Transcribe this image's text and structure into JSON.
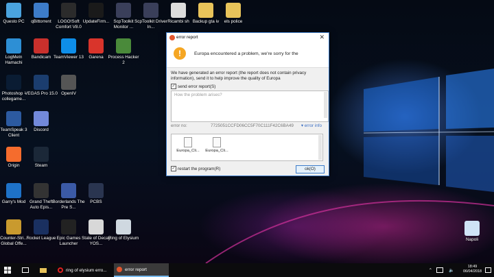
{
  "desktop_icons": [
    {
      "label": "Questo PC",
      "icon": "computer-icon",
      "color": "#4aa3df"
    },
    {
      "label": "qBittorrent",
      "icon": "qbittorrent-icon",
      "color": "#3d7cc9"
    },
    {
      "label": "LOGO!Soft Comfort V8.0",
      "icon": "logosoft-icon",
      "color": "#2b2b2b"
    },
    {
      "label": "UpdateFirm...",
      "icon": "update-firmware-icon",
      "color": "#1a1a1a"
    },
    {
      "label": "ScpToolkit Monitor ...",
      "icon": "scptoolkit-monitor-icon",
      "color": "#3a3f5a"
    },
    {
      "label": "ScpToolkit Driver In...",
      "icon": "scptoolkit-driver-icon",
      "color": "#3a3f5a"
    },
    {
      "label": "Ricambi sh",
      "icon": "file-icon",
      "color": "#dcdcdc"
    },
    {
      "label": "Backup gta iv",
      "icon": "folder-icon",
      "color": "#e8c35a"
    },
    {
      "label": "els police",
      "icon": "folder-icon",
      "color": "#e8c35a"
    },
    {
      "label": "LogMeIn Hamachi",
      "icon": "hamachi-icon",
      "color": "#2d8fd5"
    },
    {
      "label": "Bandicam",
      "icon": "bandicam-icon",
      "color": "#c9302c"
    },
    {
      "label": "TeamViewer 13",
      "icon": "teamviewer-icon",
      "color": "#0e8ee9"
    },
    {
      "label": "Garena",
      "icon": "garena-icon",
      "color": "#d9342b"
    },
    {
      "label": "Process Hacker 2",
      "icon": "process-hacker-icon",
      "color": "#4a8a3a"
    },
    {
      "label": "Photoshop - collegame...",
      "icon": "photoshop-icon",
      "color": "#0a1c33"
    },
    {
      "label": "VEGAS Pro 15.0",
      "icon": "vegas-icon",
      "color": "#1b3d6e"
    },
    {
      "label": "OpenIV",
      "icon": "openiv-icon",
      "color": "#555555"
    },
    {
      "label": "TeamSpeak 3 Client",
      "icon": "teamspeak-icon",
      "color": "#2c5aa0"
    },
    {
      "label": "Discord",
      "icon": "discord-icon",
      "color": "#7289da"
    },
    {
      "label": "Origin",
      "icon": "origin-icon",
      "color": "#f56c2d"
    },
    {
      "label": "Steam",
      "icon": "steam-icon",
      "color": "#1b2838"
    },
    {
      "label": "Garry's Mod",
      "icon": "garrys-mod-icon",
      "color": "#1e72c8"
    },
    {
      "label": "Grand Theft Auto Epis...",
      "icon": "gta-icon",
      "color": "#333333"
    },
    {
      "label": "Borderlands The Pre S...",
      "icon": "borderlands-icon",
      "color": "#3b5aa6"
    },
    {
      "label": "PCBS",
      "icon": "pcbs-icon",
      "color": "#2a3550"
    },
    {
      "label": "Counter-Stri... Global Offe...",
      "icon": "csgo-icon",
      "color": "#c99a2e"
    },
    {
      "label": "Rocket League",
      "icon": "rocket-league-icon",
      "color": "#1a3060"
    },
    {
      "label": "Epic Games Launcher",
      "icon": "epic-games-icon",
      "color": "#222222"
    },
    {
      "label": "State of Decay YOS...",
      "icon": "state-of-decay-icon",
      "color": "#d8d8d8"
    },
    {
      "label": "Ring of Elysium",
      "icon": "ring-of-elysium-icon",
      "color": "#cfd8e0"
    },
    {
      "label": "Napoli",
      "icon": "recycle-bin-icon",
      "color": "#cfe3f5"
    }
  ],
  "dialog": {
    "title": "error report",
    "message": "Europa encountered a problem, we're sorry for the",
    "body": "We have generated an error report (the report does not contain privacy information), send it to help improve the quality of Europa",
    "send_label": "send error report(S)",
    "comment_placeholder": "How the problem arises?",
    "error_label": "error no:",
    "error_code": "7725051CCFD06CC5F70C111F42C6BA49",
    "error_info": "▾ error info",
    "files": [
      "Europa_Cli...",
      "Europa_Cli..."
    ],
    "restart_label": "restart the program(R)",
    "ok_label": "ok(O)"
  },
  "taskbar": {
    "tasks": [
      {
        "label": "ring of elysium erro...",
        "active": false
      },
      {
        "label": "error report",
        "active": true
      }
    ],
    "time": "18:49",
    "date": "06/04/2018"
  }
}
